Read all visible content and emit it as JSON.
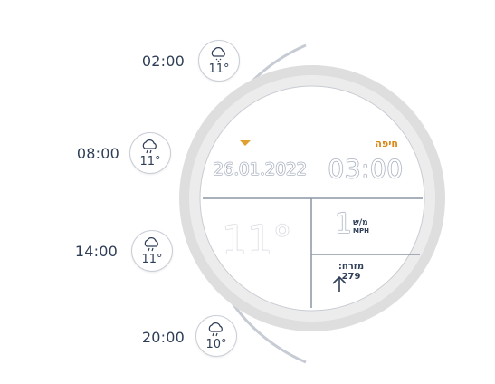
{
  "widget": {
    "city": "חיפה",
    "date": "26.01.2022",
    "time": "03:00",
    "temperature": "11°",
    "wind": {
      "speed": "1",
      "unit_line1": "מ/ש",
      "unit_line2": "MPH",
      "direction_label": "מזרח: 279"
    }
  },
  "forecast": [
    {
      "time": "02:00",
      "temp": "11°",
      "icon": "cloud-snow-icon"
    },
    {
      "time": "08:00",
      "temp": "11°",
      "icon": "cloud-rain-icon"
    },
    {
      "time": "14:00",
      "temp": "11°",
      "icon": "cloud-rain-icon"
    },
    {
      "time": "20:00",
      "temp": "10°",
      "icon": "cloud-rain-icon"
    }
  ],
  "colors": {
    "accent": "#e0a030",
    "city_text": "#d9881b",
    "ring": "#dcdcdc",
    "text": "#2f3e57"
  }
}
